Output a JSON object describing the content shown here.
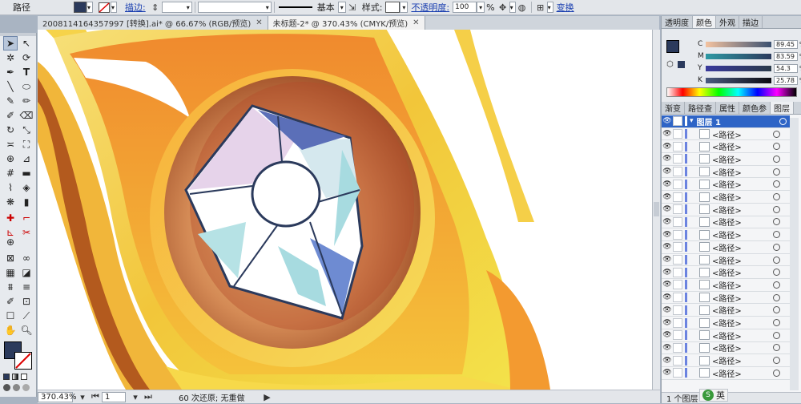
{
  "control_bar": {
    "path_label": "路径",
    "stroke_label": "描边:",
    "profile_label": "基本",
    "style_label": "样式:",
    "opacity_label": "不透明度:",
    "opacity_value": "100",
    "opacity_unit": "%",
    "transform_label": "变换"
  },
  "tabs": [
    {
      "label": "20081141643579​97 [转换].ai* @ 66.67% (RGB/预览)",
      "active": false
    },
    {
      "label": "未标题-2* @ 370.43% (CMYK/预览)",
      "active": true
    }
  ],
  "status": {
    "zoom": "370.43%",
    "page": "1",
    "undo_text": "60 次还原; 无重做"
  },
  "color_panel": {
    "tabs": [
      "透明度",
      "颜色",
      "外观",
      "描边"
    ],
    "active_tab": "颜色",
    "channels": [
      {
        "label": "C",
        "value": "89.45"
      },
      {
        "label": "M",
        "value": "83.59"
      },
      {
        "label": "Y",
        "value": "54.3"
      },
      {
        "label": "K",
        "value": "25.78"
      }
    ],
    "unit": "%"
  },
  "layers_panel": {
    "tabs": [
      "渐变",
      "路径查",
      "属性",
      "颜色参",
      "图层"
    ],
    "active_tab": "图层",
    "layer_name": "图层 1",
    "path_items": [
      "<路径>",
      "<路径>",
      "<路径>",
      "<路径>",
      "<路径>",
      "<路径>",
      "<路径>",
      "<路径>",
      "<路径>",
      "<路径>",
      "<路径>",
      "<路径>",
      "<路径>",
      "<路径>",
      "<路径>",
      "<路径>",
      "<路径>",
      "<路径>",
      "<路径>",
      "<路径>"
    ],
    "footer": "1 个图层"
  },
  "ime": {
    "label": "英"
  },
  "colors": {
    "fill": "#2b3a5c",
    "gold": "#f2c63a",
    "orange": "#e8902f",
    "brown": "#9b4a24"
  }
}
